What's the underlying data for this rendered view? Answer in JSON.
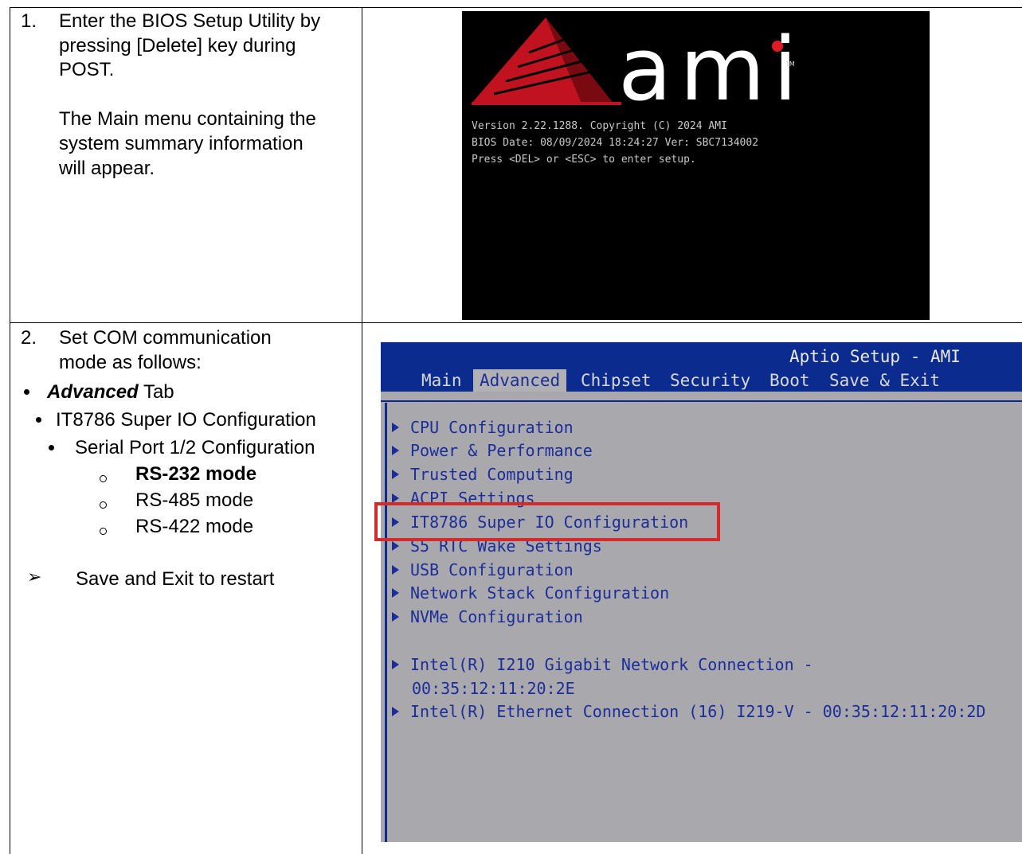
{
  "step1": {
    "number": "1.",
    "lines": [
      "Enter the BIOS Setup Utility by",
      "pressing [Delete] key during",
      "POST."
    ],
    "para2": [
      "The Main menu containing the",
      "system summary information",
      "will appear."
    ]
  },
  "ami_screen": {
    "logo_text": "ami",
    "tm": "TM",
    "version_line": "Version 2.22.1288. Copyright (C) 2024 AMI",
    "bios_date_line": "BIOS Date: 08/09/2024 18:24:27 Ver: SBC7134002",
    "press_line": "Press <DEL> or <ESC> to enter setup."
  },
  "step2": {
    "number": "2.",
    "lines": [
      "Set COM communication",
      "mode as follows:"
    ],
    "advanced_bold": "Advanced",
    "advanced_rest": " Tab",
    "io_config": "IT8786 Super IO Configuration",
    "serial_port": "Serial Port 1/2 Configuration",
    "modes": [
      "RS-232 mode",
      "RS-485 mode",
      "RS-422 mode"
    ],
    "save_exit": "Save and Exit to restart",
    "colors": {
      "highlight_box": "#d52a2a"
    }
  },
  "aptio": {
    "title": "Aptio Setup - AMI",
    "tabs": [
      "Main",
      "Advanced",
      "Chipset",
      "Security",
      "Boot",
      "Save & Exit"
    ],
    "active_tab": "Advanced",
    "items": [
      "CPU Configuration",
      "Power & Performance",
      "Trusted Computing",
      "ACPI Settings",
      "IT8786 Super IO Configuration",
      "S5 RTC Wake Settings",
      "USB Configuration",
      "Network Stack Configuration",
      "NVMe Configuration"
    ],
    "nic1_line1": "Intel(R) I210 Gigabit  Network Connection -",
    "nic1_line2": "00:35:12:11:20:2E",
    "nic2": "Intel(R) Ethernet Connection (16) I219-V - 00:35:12:11:20:2D",
    "colors": {
      "header_bg": "#0b2c8e",
      "body_bg": "#a9a9ad",
      "item_text": "#1c2d9a"
    }
  }
}
